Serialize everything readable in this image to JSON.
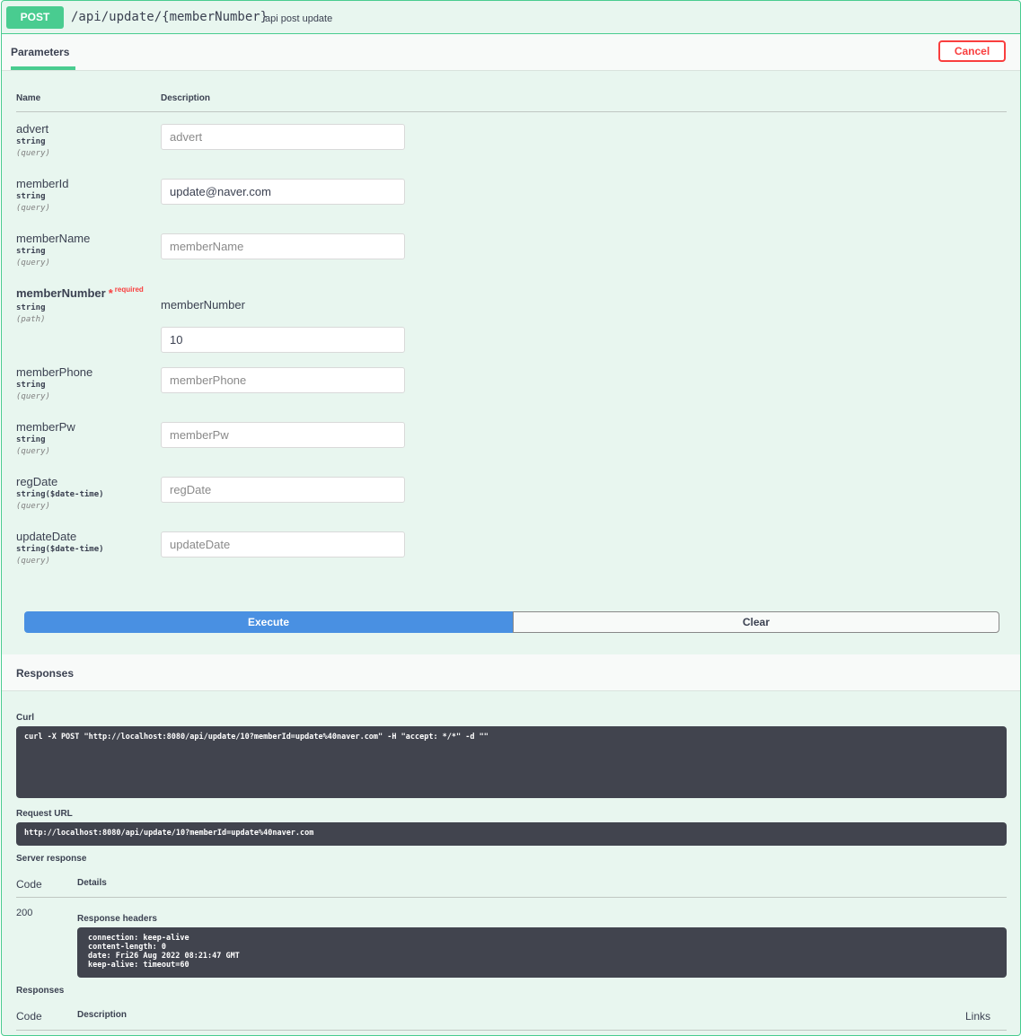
{
  "operation": {
    "method": "POST",
    "path": "/api/update/{memberNumber}",
    "summary": "api post update"
  },
  "tabs": {
    "parameters": "Parameters",
    "cancel": "Cancel"
  },
  "columns": {
    "name": "Name",
    "description": "Description"
  },
  "params": [
    {
      "name": "advert",
      "type": "string",
      "in": "(query)",
      "value": "",
      "placeholder": "advert"
    },
    {
      "name": "memberId",
      "type": "string",
      "in": "(query)",
      "value": "update@naver.com",
      "placeholder": "memberId"
    },
    {
      "name": "memberName",
      "type": "string",
      "in": "(query)",
      "value": "",
      "placeholder": "memberName"
    },
    {
      "name": "memberNumber",
      "type": "string",
      "in": "(path)",
      "value": "10",
      "placeholder": "memberNumber",
      "required_mark": "*",
      "required_text": "required",
      "description": "memberNumber"
    },
    {
      "name": "memberPhone",
      "type": "string",
      "in": "(query)",
      "value": "",
      "placeholder": "memberPhone"
    },
    {
      "name": "memberPw",
      "type": "string",
      "in": "(query)",
      "value": "",
      "placeholder": "memberPw"
    },
    {
      "name": "regDate",
      "type": "string($date-time)",
      "in": "(query)",
      "value": "",
      "placeholder": "regDate"
    },
    {
      "name": "updateDate",
      "type": "string($date-time)",
      "in": "(query)",
      "value": "",
      "placeholder": "updateDate"
    }
  ],
  "actions": {
    "execute": "Execute",
    "clear": "Clear"
  },
  "responses": {
    "title": "Responses",
    "curl_label": "Curl",
    "curl": "curl -X POST \"http://localhost:8080/api/update/10?memberId=update%40naver.com\" -H \"accept: */*\" -d \"\"",
    "request_url_label": "Request URL",
    "request_url": "http://localhost:8080/api/update/10?memberId=update%40naver.com",
    "server_response_label": "Server response",
    "code_header": "Code",
    "details_header": "Details",
    "code": "200",
    "response_headers_label": "Response headers",
    "headers": [
      "connection: keep-alive",
      "content-length: 0",
      "date: Fri26 Aug 2022 08:21:47 GMT",
      "keep-alive: timeout=60"
    ],
    "responses_label": "Responses",
    "code_header2": "Code",
    "description_header": "Description",
    "links_header": "Links"
  }
}
